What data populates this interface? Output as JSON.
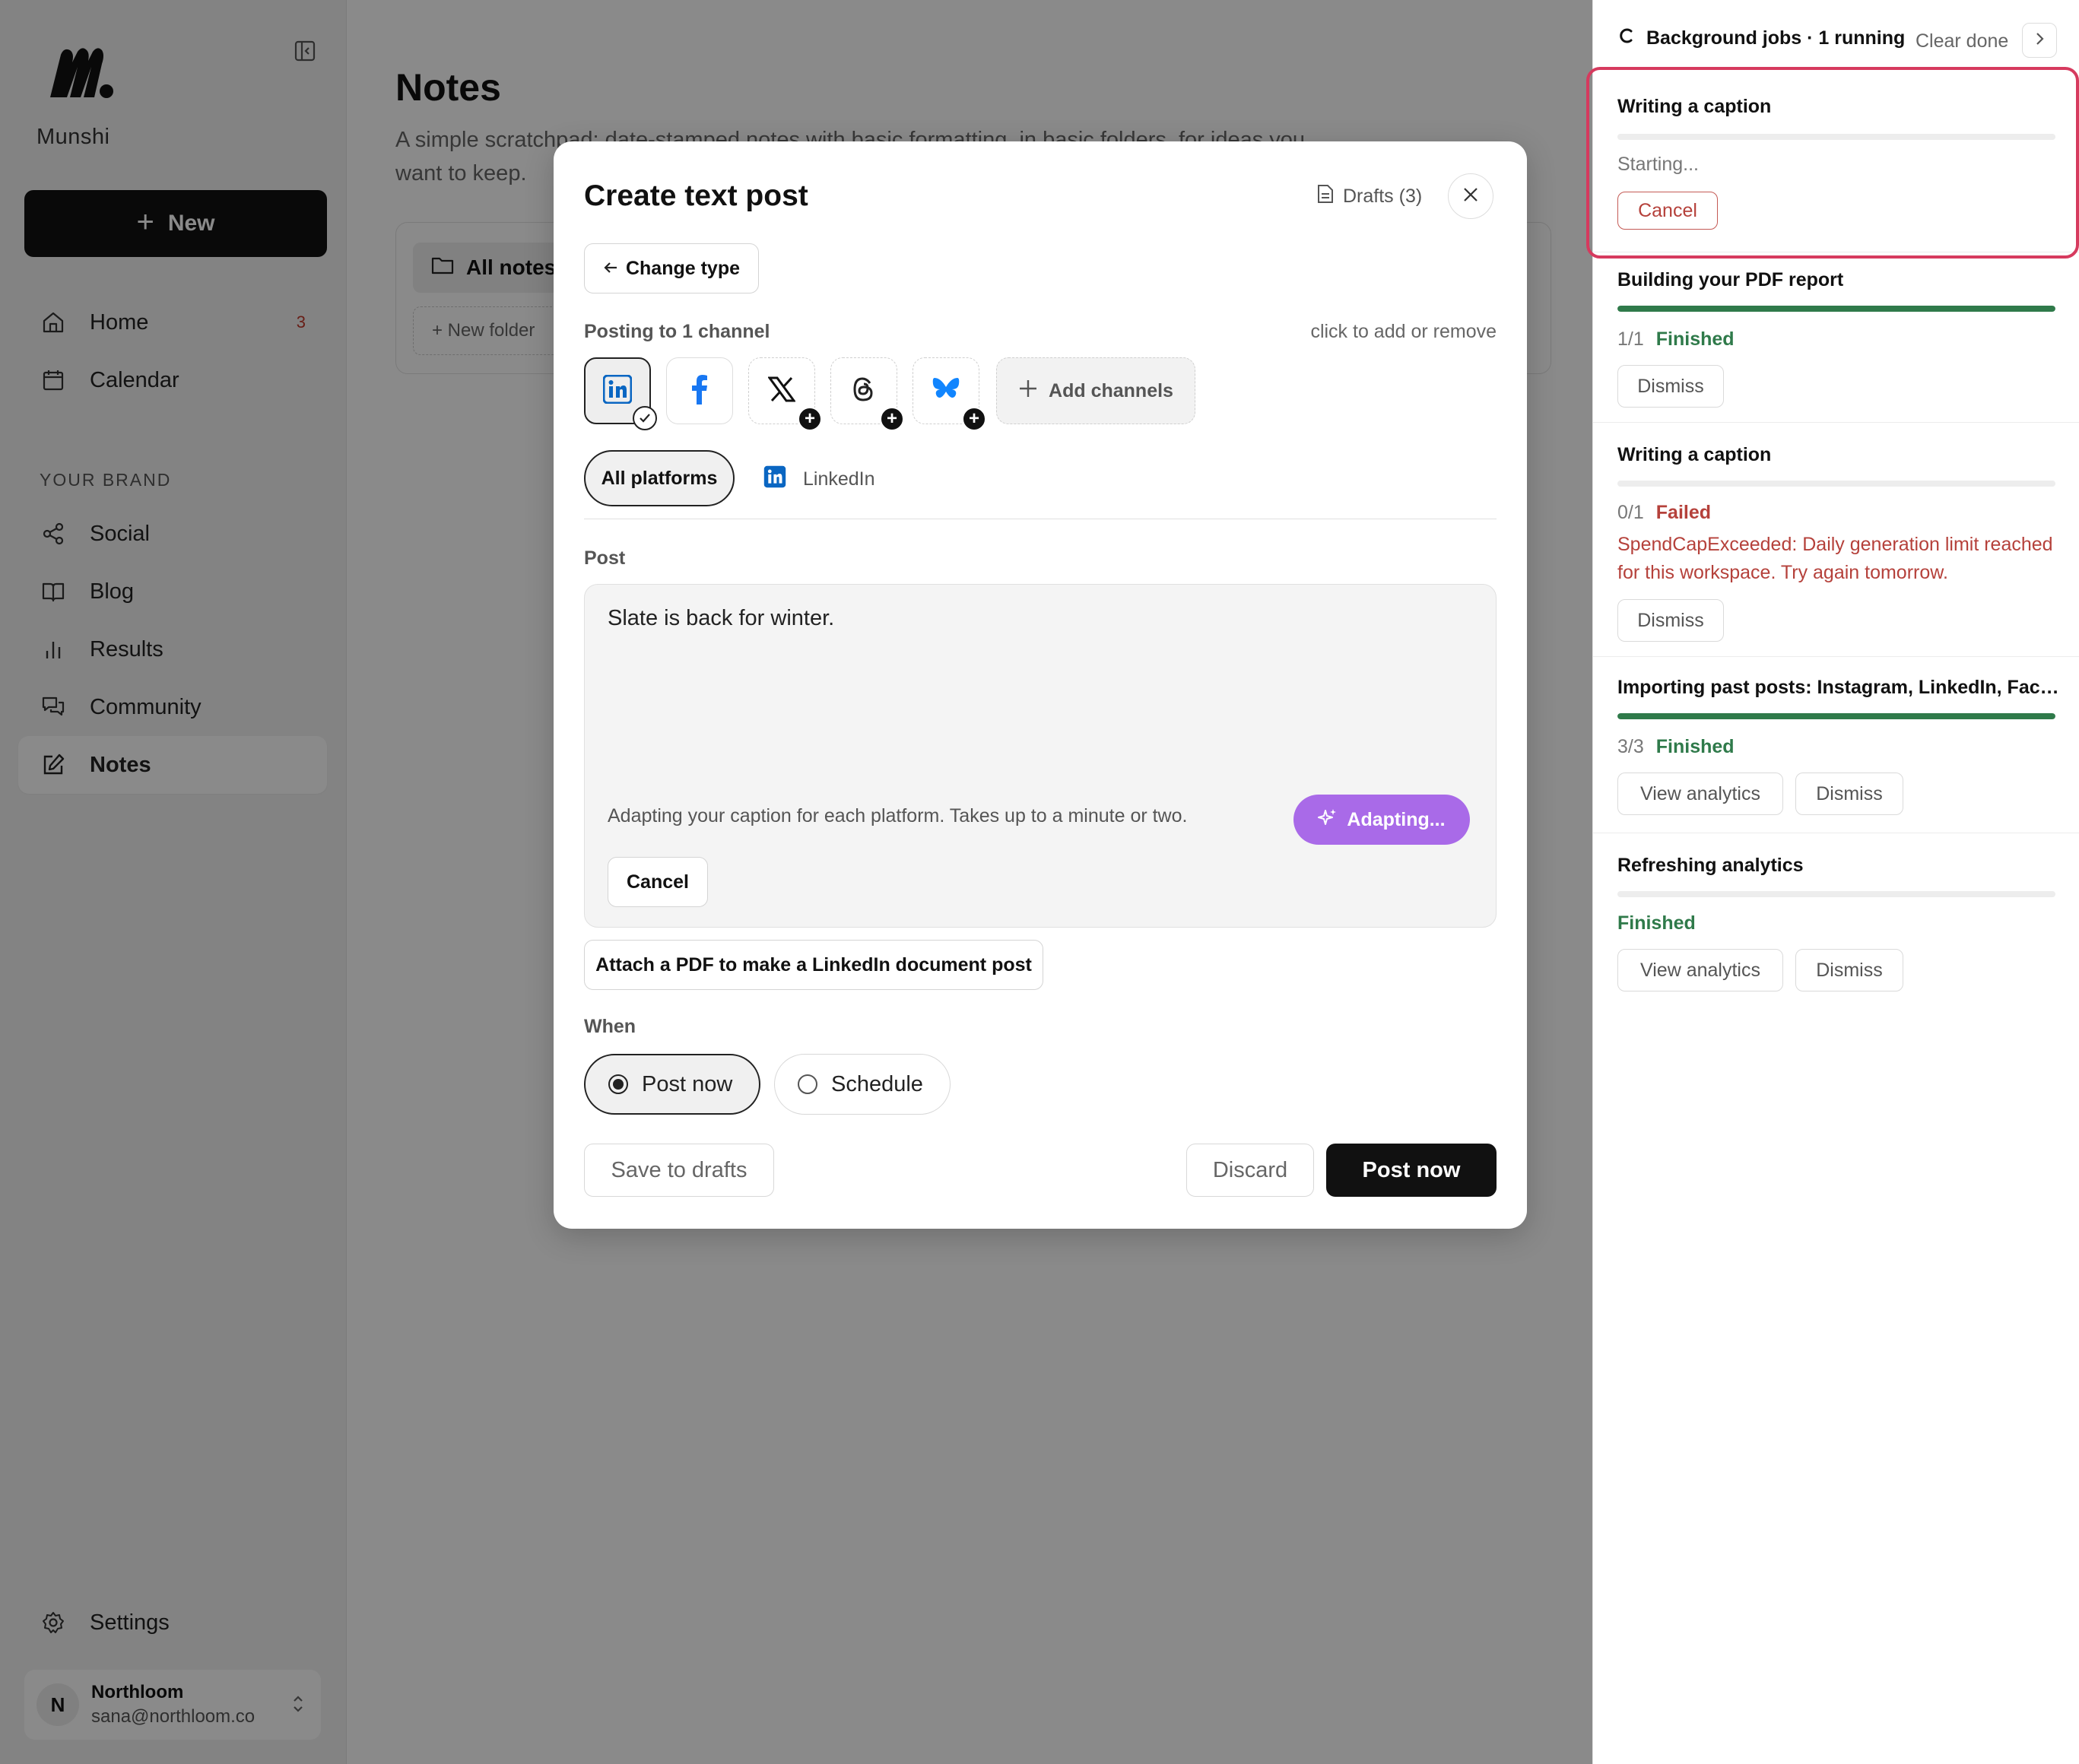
{
  "sidebar": {
    "brand": "Munshi",
    "new_label": "New",
    "nav": [
      {
        "label": "Home",
        "icon": "home-icon",
        "badge": "3"
      },
      {
        "label": "Calendar",
        "icon": "calendar-icon"
      }
    ],
    "section_label": "YOUR BRAND",
    "brand_nav": [
      {
        "label": "Social",
        "icon": "share-icon"
      },
      {
        "label": "Blog",
        "icon": "book-icon"
      },
      {
        "label": "Results",
        "icon": "bar-chart-icon"
      },
      {
        "label": "Community",
        "icon": "chat-icon"
      },
      {
        "label": "Notes",
        "icon": "edit-icon",
        "active": true
      }
    ],
    "settings_label": "Settings",
    "account": {
      "initial": "N",
      "name": "Northloom",
      "email": "sana@northloom.co"
    }
  },
  "main": {
    "title": "Notes",
    "subtitle": "A simple scratchpad: date-stamped notes with basic formatting, in basic folders, for ideas you want to keep.",
    "all_notes": "All notes",
    "new_folder": "+ New folder"
  },
  "modal": {
    "title": "Create text post",
    "drafts": "Drafts (3)",
    "change_type": "Change type",
    "posting_to": "Posting to 1 channel",
    "click_hint": "click to add or remove",
    "add_channels": "Add channels",
    "tab_all": "All platforms",
    "tab_linkedin": "LinkedIn",
    "post_label": "Post",
    "post_text": "Slate is back for winter.",
    "adapt_note": "Adapting your caption for each platform. Takes up to a minute or two.",
    "adapting_label": "Adapting...",
    "cancel_label": "Cancel",
    "attach_label": "Attach a PDF to make a LinkedIn document post",
    "when_label": "When",
    "post_now_radio": "Post now",
    "schedule_radio": "Schedule",
    "save_drafts": "Save to drafts",
    "discard": "Discard",
    "post_now_btn": "Post now"
  },
  "jobs_panel": {
    "header": "Background jobs · 1 running",
    "clear_done": "Clear done",
    "jobs": [
      {
        "title": "Writing a caption",
        "status": "Starting...",
        "progress": 0,
        "buttons": [
          "Cancel"
        ]
      },
      {
        "title": "Building your PDF report",
        "count": "1/1",
        "status": "Finished",
        "progress": 1,
        "buttons": [
          "Dismiss"
        ]
      },
      {
        "title": "Writing a caption",
        "count": "0/1",
        "status": "Failed",
        "progress": 0,
        "error": "SpendCapExceeded: Daily generation limit reached for this workspace. Try again tomorrow.",
        "buttons": [
          "Dismiss"
        ]
      },
      {
        "title": "Importing past posts: Instagram, LinkedIn, Face...",
        "count": "3/3",
        "status": "Finished",
        "progress": 1,
        "buttons": [
          "View analytics",
          "Dismiss"
        ]
      },
      {
        "title": "Refreshing analytics",
        "status": "Finished",
        "progress": 0,
        "buttons": [
          "View analytics",
          "Dismiss"
        ]
      }
    ]
  },
  "colors": {
    "accent_purple": "#a96ae8",
    "success": "#2f7a4a",
    "error": "#b5413b",
    "highlight": "#d63a5e"
  }
}
